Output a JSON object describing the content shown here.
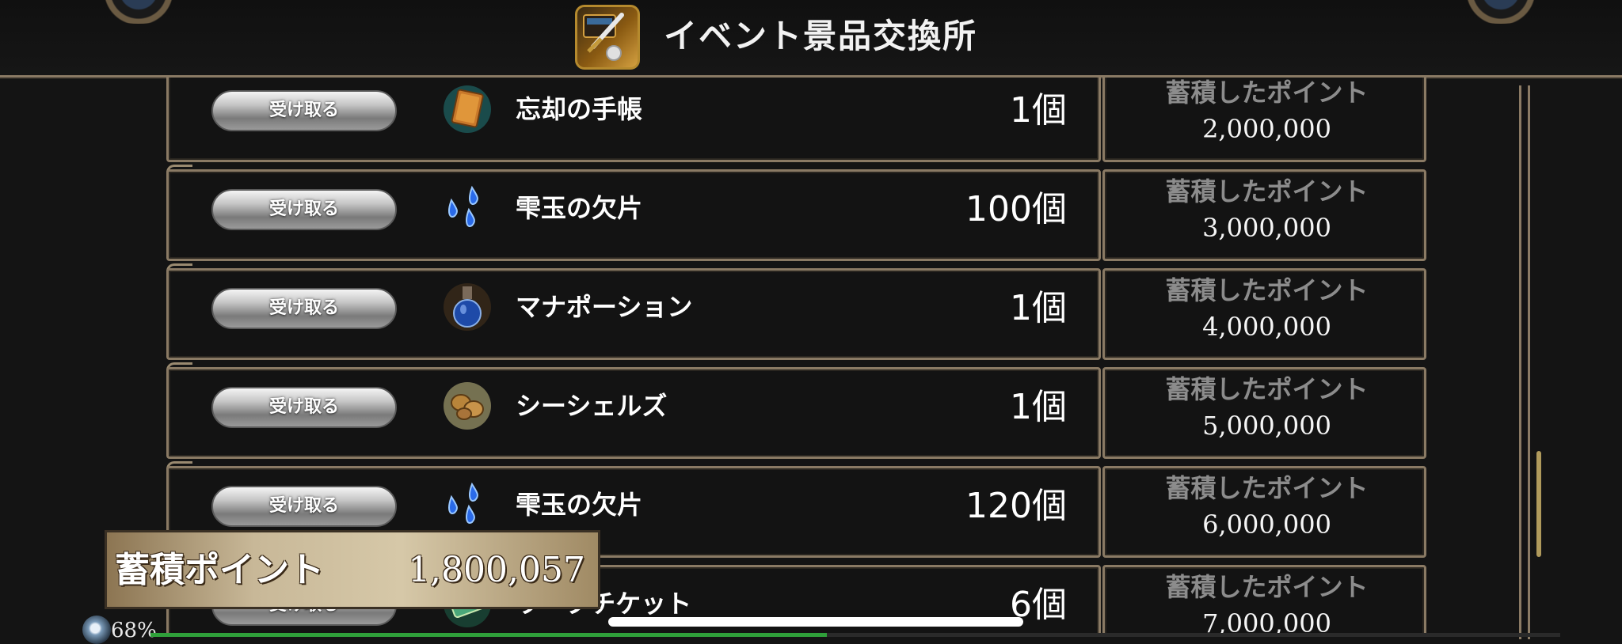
{
  "header": {
    "title": "イベント景品交換所",
    "icon": "treasure-chest-sword-icon"
  },
  "rows": [
    {
      "button": "受け取る",
      "icon": "book-icon",
      "name": "忘却の手帳",
      "qty": "1個",
      "req_label": "蓄積したポイント",
      "req_value": "2,000,000"
    },
    {
      "button": "受け取る",
      "icon": "blue-droplets-icon",
      "name": "雫玉の欠片",
      "qty": "100個",
      "req_label": "蓄積したポイント",
      "req_value": "3,000,000"
    },
    {
      "button": "受け取る",
      "icon": "potion-icon",
      "name": "マナポーション",
      "qty": "1個",
      "req_label": "蓄積したポイント",
      "req_value": "4,000,000"
    },
    {
      "button": "受け取る",
      "icon": "shells-icon",
      "name": "シーシェルズ",
      "qty": "1個",
      "req_label": "蓄積したポイント",
      "req_value": "5,000,000"
    },
    {
      "button": "受け取る",
      "icon": "blue-droplets-icon",
      "name": "雫玉の欠片",
      "qty": "120個",
      "req_label": "蓄積したポイント",
      "req_value": "6,000,000"
    },
    {
      "button": "受け取る",
      "icon": "ticket-icon",
      "name": "ワープチケット",
      "qty": "6個",
      "req_label": "蓄積したポイント",
      "req_value": "7,000,000"
    }
  ],
  "total": {
    "label": "蓄積ポイント",
    "value": "1,800,057"
  },
  "status": {
    "battery": "68%",
    "progress": 0.48
  },
  "colors": {
    "frame": "#8a7a64",
    "background": "#141414",
    "progress": "#2fa03a"
  }
}
